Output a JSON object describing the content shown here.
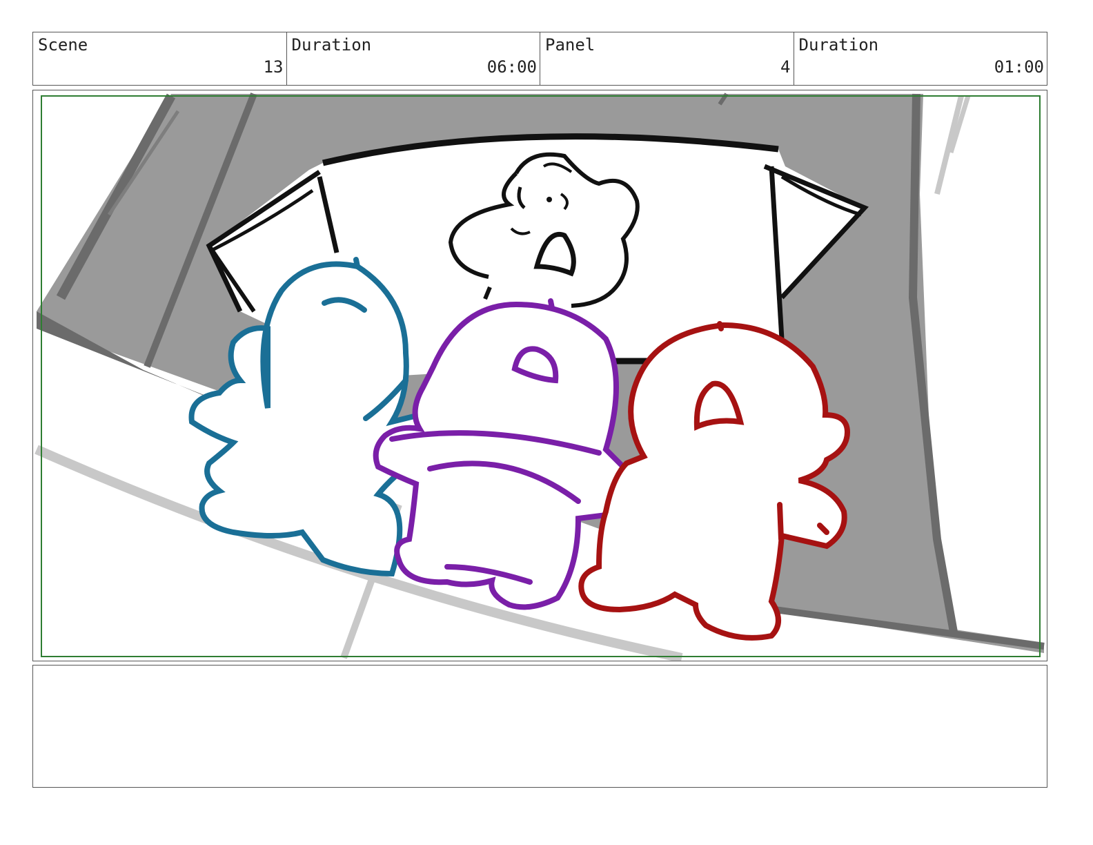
{
  "header": {
    "scene": {
      "label": "Scene",
      "value": "13"
    },
    "scene_duration": {
      "label": "Duration",
      "value": "06:00"
    },
    "panel": {
      "label": "Panel",
      "value": "4"
    },
    "panel_duration": {
      "label": "Duration",
      "value": "01:00"
    }
  },
  "colors": {
    "frame_guide": "#2e7d32",
    "wall_gray": "#9a9a9a",
    "wall_dark": "#6b6b6b",
    "floor_line": "#c8c8c8",
    "ink": "#111111",
    "character_blue": "#1a6f96",
    "character_purple": "#7a1fa8",
    "character_red": "#a61212"
  },
  "notes": {
    "text": ""
  }
}
